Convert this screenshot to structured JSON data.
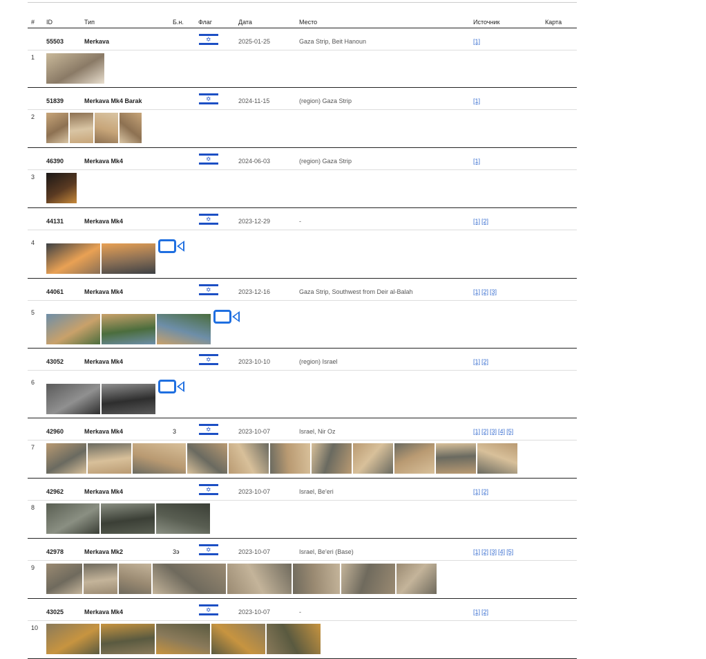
{
  "header": {
    "num": "#",
    "id": "ID",
    "type": "Тип",
    "bn": "Б.н.",
    "flag": "Флаг",
    "date": "Дата",
    "place": "Место",
    "source": "Источник",
    "map": "Карта"
  },
  "rows": [
    {
      "num": "1",
      "id": "55503",
      "type": "Merkava",
      "bn": "",
      "date": "2025-01-25",
      "place": "Gaza Strip, Beit Hanoun",
      "sources": [
        "[1]"
      ],
      "photo_count": 1,
      "video": false
    },
    {
      "num": "2",
      "id": "51839",
      "type": "Merkava Mk4 Barak",
      "bn": "",
      "date": "2024-11-15",
      "place": "(region) Gaza Strip",
      "sources": [
        "[1]"
      ],
      "photo_count": 4,
      "video": false
    },
    {
      "num": "3",
      "id": "46390",
      "type": "Merkava Mk4",
      "bn": "",
      "date": "2024-06-03",
      "place": "(region) Gaza Strip",
      "sources": [
        "[1]"
      ],
      "photo_count": 1,
      "video": false
    },
    {
      "num": "4",
      "id": "44131",
      "type": "Merkava Mk4",
      "bn": "",
      "date": "2023-12-29",
      "place": "-",
      "sources": [
        "[1]",
        "[2]"
      ],
      "photo_count": 2,
      "video": true
    },
    {
      "num": "5",
      "id": "44061",
      "type": "Merkava Mk4",
      "bn": "",
      "date": "2023-12-16",
      "place": "Gaza Strip, Southwest from Deir al-Balah",
      "sources": [
        "[1]",
        "[2]",
        "[3]"
      ],
      "photo_count": 3,
      "video": true
    },
    {
      "num": "6",
      "id": "43052",
      "type": "Merkava Mk4",
      "bn": "",
      "date": "2023-10-10",
      "place": "(region) Israel",
      "sources": [
        "[1]",
        "[2]"
      ],
      "photo_count": 2,
      "video": true
    },
    {
      "num": "7",
      "id": "42960",
      "type": "Merkava Mk4",
      "bn": "3",
      "date": "2023-10-07",
      "place": "Israel, Nir Oz",
      "sources": [
        "[1]",
        "[2]",
        "[3]",
        "[4]",
        "[5]"
      ],
      "photo_count": 11,
      "video": false
    },
    {
      "num": "8",
      "id": "42962",
      "type": "Merkava Mk4",
      "bn": "",
      "date": "2023-10-07",
      "place": "Israel, Be'eri",
      "sources": [
        "[1]",
        "[2]"
      ],
      "photo_count": 3,
      "video": false
    },
    {
      "num": "9",
      "id": "42978",
      "type": "Merkava Mk2",
      "bn": "3э",
      "date": "2023-10-07",
      "place": "Israel, Be'eri (Base)",
      "sources": [
        "[1]",
        "[2]",
        "[3]",
        "[4]",
        "[5]"
      ],
      "photo_count": 8,
      "video": false
    },
    {
      "num": "10",
      "id": "43025",
      "type": "Merkava Mk4",
      "bn": "",
      "date": "2023-10-07",
      "place": "-",
      "sources": [
        "[1]",
        "[2]"
      ],
      "photo_count": 5,
      "video": false
    }
  ],
  "colors": {
    "flag_blue": "#1c4fc4",
    "link": "#3a6fd0",
    "video_icon": "#1f6fe0"
  },
  "icons": {
    "flag": "israel-flag-icon",
    "video": "video-camera-icon"
  }
}
